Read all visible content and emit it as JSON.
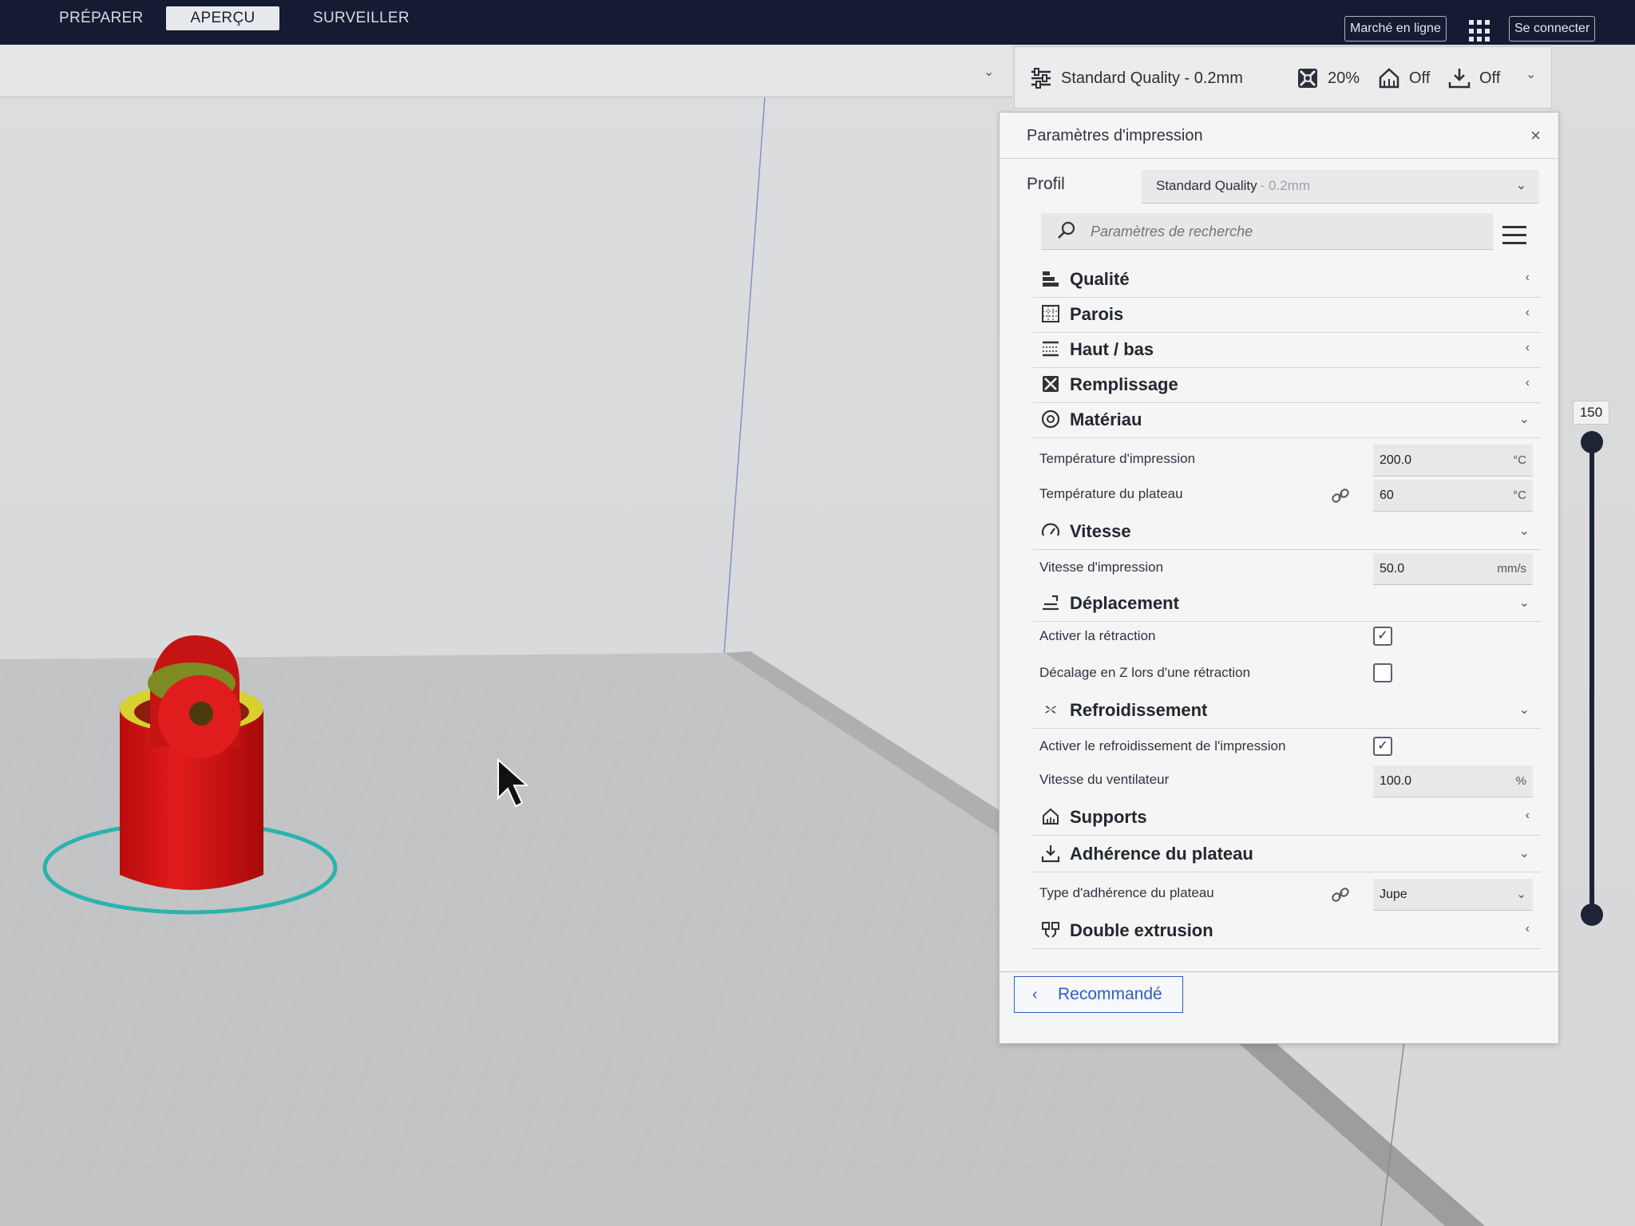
{
  "app": {
    "nav_tabs": [
      {
        "label": "PRÉPARER",
        "active": false
      },
      {
        "label": "APERÇU",
        "active": true
      },
      {
        "label": "SURVEILLER",
        "active": false
      }
    ],
    "marketplace_label": "Marché en ligne",
    "signin_label": "Se connecter",
    "accent_color": "#2d5dcc",
    "header_color": "#141b33"
  },
  "setup_bar": {
    "profile_label": "Standard Quality - 0.2mm",
    "infill_value": "20%",
    "support_value": "Off",
    "adhesion_value": "Off"
  },
  "panel": {
    "title": "Paramètres d'impression",
    "close_glyph": "×",
    "profile_label": "Profil",
    "profile_value": "Standard Quality",
    "profile_sub": "- 0.2mm",
    "search_placeholder": "Paramètres de recherche",
    "sections": [
      {
        "title": "Qualité",
        "icon": "quality-icon",
        "expanded": false
      },
      {
        "title": "Parois",
        "icon": "walls-icon",
        "expanded": false
      },
      {
        "title": "Haut / bas",
        "icon": "top-bottom-icon",
        "expanded": false
      },
      {
        "title": "Remplissage",
        "icon": "infill-icon",
        "expanded": false
      },
      {
        "title": "Matériau",
        "icon": "material-icon",
        "expanded": true
      },
      {
        "title": "Vitesse",
        "icon": "speed-icon",
        "expanded": true
      },
      {
        "title": "Déplacement",
        "icon": "travel-icon",
        "expanded": true
      },
      {
        "title": "Refroidissement",
        "icon": "cooling-icon",
        "expanded": true
      },
      {
        "title": "Supports",
        "icon": "support-icon",
        "expanded": false
      },
      {
        "title": "Adhérence du plateau",
        "icon": "adhesion-icon",
        "expanded": true
      },
      {
        "title": "Double extrusion",
        "icon": "dual-extrusion-icon",
        "expanded": false
      }
    ],
    "settings": {
      "print_temp": {
        "label": "Température d'impression",
        "value": "200.0",
        "unit": "°C"
      },
      "bed_temp": {
        "label": "Température du plateau",
        "value": "60",
        "unit": "°C"
      },
      "print_speed": {
        "label": "Vitesse d'impression",
        "value": "50.0",
        "unit": "mm/s"
      },
      "retraction": {
        "label": "Activer la rétraction",
        "checked": true
      },
      "z_hop": {
        "label": "Décalage en Z lors d'une rétraction",
        "checked": false
      },
      "cooling": {
        "label": "Activer le refroidissement de l'impression",
        "checked": true
      },
      "fan_speed": {
        "label": "Vitesse du ventilateur",
        "value": "100.0",
        "unit": "%"
      },
      "adhesion_type": {
        "label": "Type d'adhérence du plateau",
        "value": "Jupe"
      }
    },
    "recommended_label": "Recommandé"
  },
  "layer_slider": {
    "top_value": "150"
  }
}
